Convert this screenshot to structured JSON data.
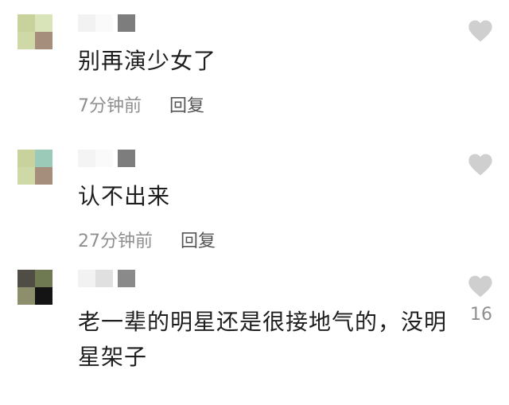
{
  "colors": {
    "heart": "#cfcfcf",
    "text": "#1e1e1e",
    "meta": "#8f8f8f"
  },
  "comments": [
    {
      "text": "别再演少女了",
      "time": "7分钟前",
      "reply": "回复",
      "likes": ""
    },
    {
      "text": "认不出来",
      "time": "27分钟前",
      "reply": "回复",
      "likes": ""
    },
    {
      "text": "老一辈的明星还是很接地气的，没明星架子",
      "time": "",
      "reply": "",
      "likes": "16"
    }
  ]
}
